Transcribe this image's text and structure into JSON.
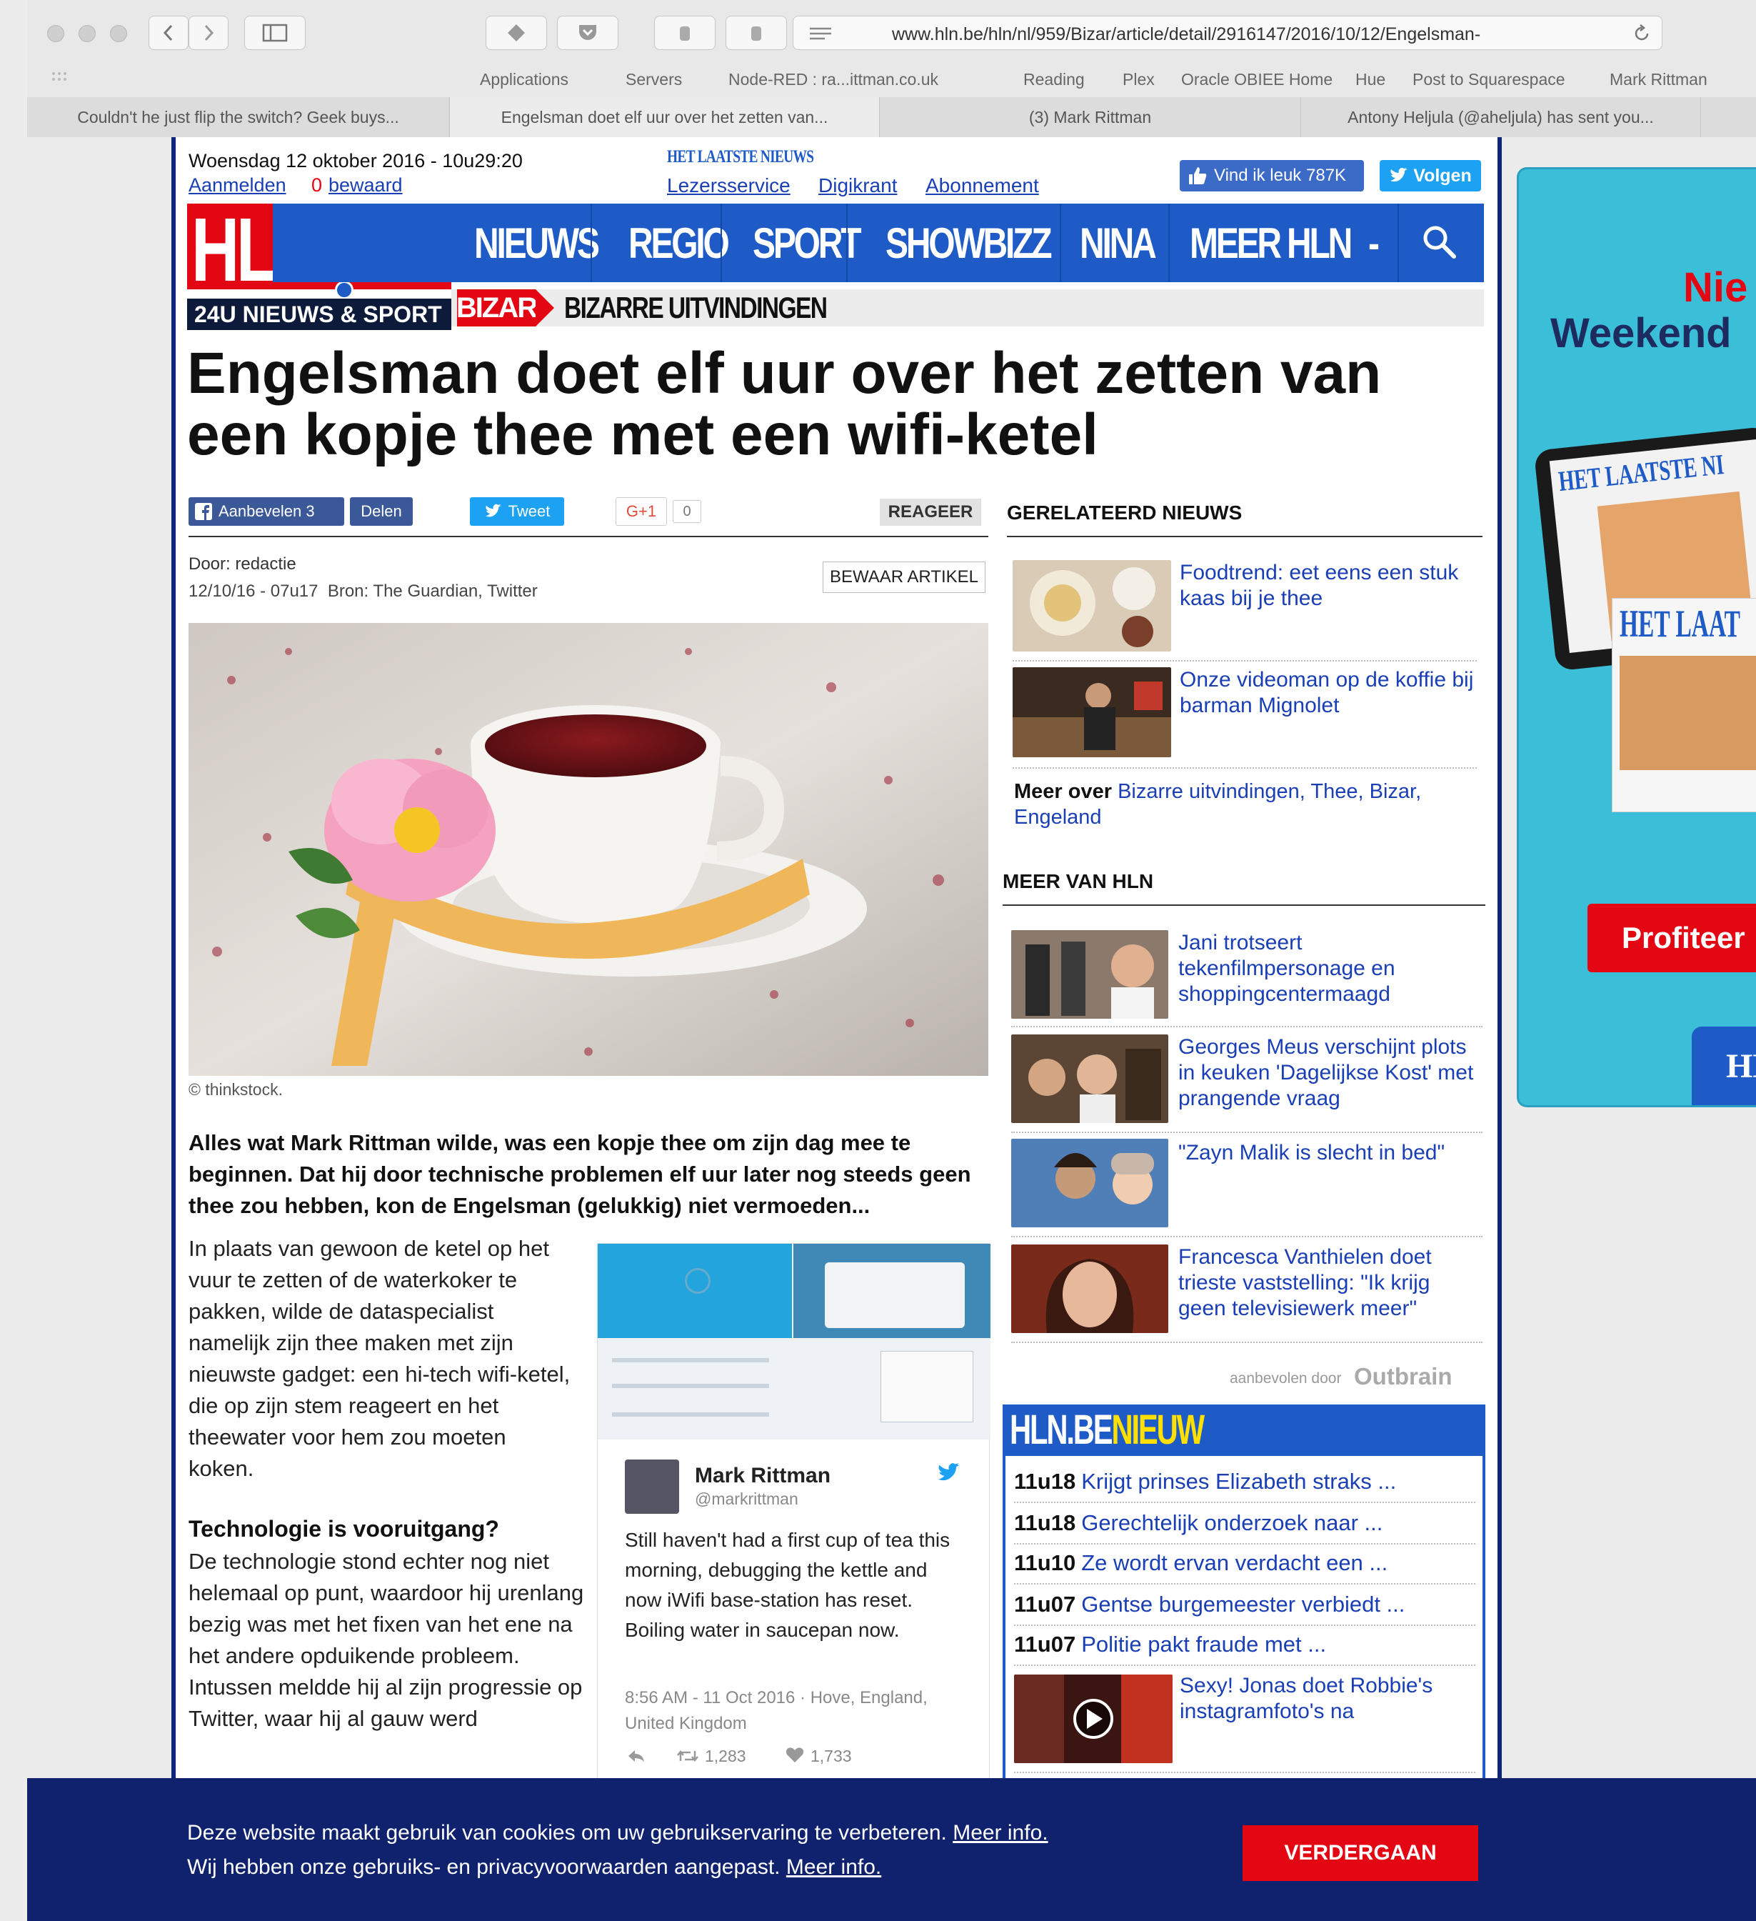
{
  "browser": {
    "url": "www.hln.be/hln/nl/959/Bizar/article/detail/2916147/2016/10/12/Engelsman-",
    "bookmarks": [
      "Applications",
      "Servers",
      "Node-RED : ra...ittman.co.uk",
      "Reading",
      "Plex",
      "Oracle OBIEE Home",
      "Hue",
      "Post to Squarespace",
      "Mark Rittman"
    ],
    "tabs": [
      "Couldn't he just flip the switch? Geek buys...",
      "Engelsman doet elf uur over het zetten van...",
      "(3) Mark Rittman",
      "Antony Heljula (@aheljula) has sent you..."
    ]
  },
  "topbar": {
    "date": "Woensdag 12 oktober 2016 - 10u29:20",
    "login": "Aanmelden",
    "saved_count": "0",
    "saved": "bewaard",
    "hln_brand": "HET LAATSTE NIEUWS",
    "links": [
      "Lezersservice",
      "Digikrant",
      "Abonnement"
    ],
    "like": "Vind ik leuk 787K",
    "follow": "Volgen"
  },
  "logo": {
    "text": "HLN.BE",
    "tagline": "24U NIEUWS & SPORT"
  },
  "nav": {
    "items": [
      "NIEUWS",
      "REGIO",
      "SPORT",
      "SHOWBIZZ",
      "NINA",
      "MEER HLN"
    ],
    "dropdown": "-"
  },
  "section": {
    "tag": "BIZAR",
    "sub": "BIZARRE UITVINDINGEN"
  },
  "article": {
    "title": "Engelsman doet elf uur over het zetten van een kopje thee met een wifi-ketel",
    "share": {
      "recommend": "Aanbevelen 3",
      "share": "Delen",
      "tweet": "Tweet",
      "gplus": "G+1",
      "gplus_count": "0",
      "react": "REAGEER"
    },
    "author": "Door: redactie",
    "meta": "12/10/16 - 07u17  Bron: The Guardian, Twitter",
    "save": "BEWAAR ARTIKEL",
    "caption": "© thinkstock.",
    "lead": "Alles wat Mark Rittman wilde, was een kopje thee om zijn dag mee te beginnen. Dat hij door technische problemen elf uur later nog steeds geen thee zou hebben, kon de Engelsman (gelukkig) niet vermoeden...",
    "p1": "In plaats van gewoon de ketel op het vuur te zetten of de waterkoker te pakken, wilde de dataspecialist namelijk zijn thee maken met zijn nieuwste gadget: een hi-tech wifi-ketel, die op zijn stem reageert en het theewater voor hem zou moeten koken.",
    "h2": "Technologie is vooruitgang?",
    "p2": "De technologie stond echter nog niet helemaal op punt, waardoor hij urenlang bezig was met het fixen van het ene na het andere opduikende probleem. Intussen meldde hij al zijn progressie op Twitter, waar hij al gauw werd"
  },
  "tweet": {
    "name": "Mark Rittman",
    "handle": "@markrittman",
    "text": "Still haven't had a first cup of tea this morning, debugging the kettle and now iWifi base-station has reset. Boiling water in saucepan now.",
    "time": "8:56 AM - 11 Oct 2016 · Hove, England, United Kingdom",
    "retweets": "1,283",
    "likes": "1,733"
  },
  "related": {
    "title": "GERELATEERD NIEUWS",
    "items": [
      "Foodtrend: eet eens een stuk kaas bij je thee",
      "Onze videoman op de koffie bij barman Mignolet"
    ],
    "more_label": "Meer over",
    "tags": [
      "Bizarre uitvindingen",
      "Thee",
      "Bizar",
      "Engeland"
    ]
  },
  "more_hln": {
    "title": "MEER VAN HLN",
    "items": [
      "Jani trotseert tekenfilmpersonage en shoppingcentermaagd",
      "Georges Meus verschijnt plots in keuken 'Dagelijkse Kost' met prangende vraag",
      "\"Zayn Malik is slecht in bed\"",
      "Francesca Vanthielen doet trieste vaststelling: \"Ik krijg geen televisiewerk meer\""
    ],
    "outbrain_label": "aanbevolen door",
    "outbrain": "Outbrain"
  },
  "hln_nieuw": {
    "title_a": "HLN.BE",
    "title_b": "NIEUW",
    "items": [
      {
        "time": "11u18",
        "text": "Krijgt prinses Elizabeth straks ..."
      },
      {
        "time": "11u18",
        "text": "Gerechtelijk onderzoek naar ..."
      },
      {
        "time": "11u10",
        "text": "Ze wordt ervan verdacht een ..."
      },
      {
        "time": "11u07",
        "text": "Gentse burgemeester verbiedt ..."
      },
      {
        "time": "11u07",
        "text": "Politie pakt fraude met ..."
      }
    ],
    "video": "Sexy! Jonas doet Robbie's instagramfoto's na"
  },
  "ad": {
    "line1": "Nie",
    "line2": "Weekend",
    "cta": "Profiteer",
    "brand1": "HET LAATSTE NI",
    "brand2": "HET LAAT",
    "bottom": "HE"
  },
  "cookie": {
    "line1": "Deze website maakt gebruik van cookies om uw gebruikservaring te verbeteren.",
    "line2": "Wij hebben onze gebruiks- en privacyvoorwaarden aangepast.",
    "more1": "Meer info.",
    "more2": "Meer info.",
    "button": "VERDERGAAN"
  },
  "colors": {
    "hln_blue": "#1e5bc6",
    "hln_red": "#e30613",
    "link": "#1a3fb5",
    "cookie_bg": "#10226e"
  }
}
